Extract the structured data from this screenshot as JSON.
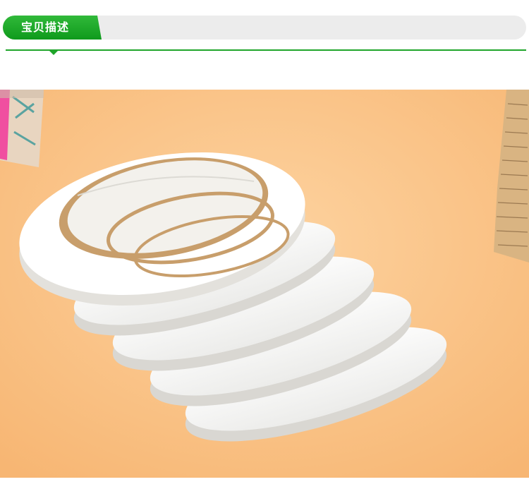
{
  "header": {
    "title": "宝贝描述"
  },
  "colors": {
    "accent": "#1fa52a",
    "bar": "#ececec",
    "background": "#fbc68a"
  }
}
